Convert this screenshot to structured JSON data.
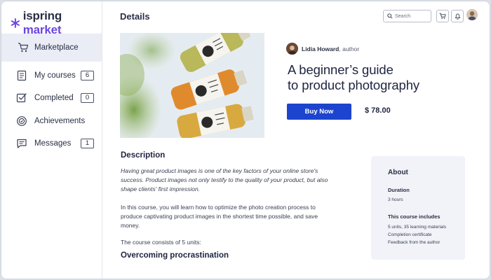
{
  "brand": {
    "name_part1": "ispring",
    "name_part2": "market",
    "accent": "#6b45e0"
  },
  "sidebar": {
    "items": [
      {
        "label": "Marketplace",
        "icon": "cart-icon",
        "active": true
      },
      {
        "label": "My courses",
        "icon": "courses-icon",
        "count": "6"
      },
      {
        "label": "Completed",
        "icon": "completed-icon",
        "count": "0"
      },
      {
        "label": "Achievements",
        "icon": "achievements-icon"
      },
      {
        "label": "Messages",
        "icon": "messages-icon",
        "count": "1"
      }
    ]
  },
  "header": {
    "title": "Details",
    "search_placeholder": "Search"
  },
  "course": {
    "author_name": "Lidia Howard",
    "author_role": ", author",
    "title_line1": "A beginner’s guide",
    "title_line2": "to product photography",
    "buy_label": "Buy Now",
    "price": "$ 78.00",
    "buy_color": "#1c44cf"
  },
  "description": {
    "heading": "Description",
    "paragraph1": "Having great product images is one of the key factors of your online store's success. Product images not only testify to the quality of your product, but also shape clients' first impression.",
    "paragraph2": "In this course, you will learn how to optimize the photo creation process to produce captivating product images in the shortest time possible, and save money.",
    "paragraph3": "The course consists of 5 units:",
    "unit1_heading": "Overcoming procrastination"
  },
  "about": {
    "title": "About",
    "duration_label": "Duration",
    "duration_value": "3 hours",
    "includes_label": "This course includes",
    "includes": [
      "5 units, 35 learning materials",
      "Completion certificate",
      "Feedback from the author"
    ]
  }
}
